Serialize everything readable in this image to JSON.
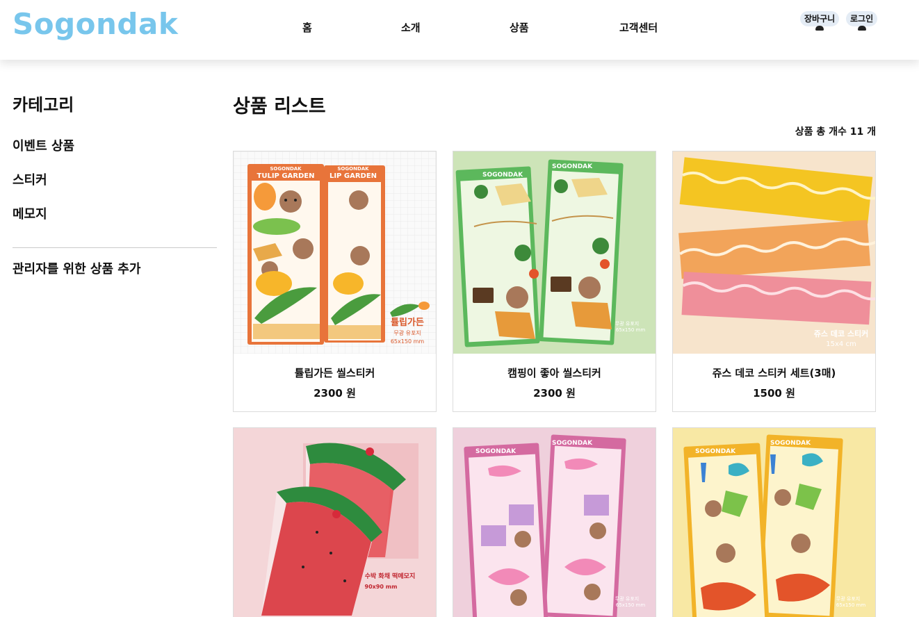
{
  "header": {
    "logo": "Sogondak",
    "nav": [
      "홈",
      "소개",
      "상품",
      "고객센터"
    ],
    "cart": "장바구니",
    "login": "로그인"
  },
  "sidebar": {
    "title": "카테고리",
    "items": [
      "이벤트 상품",
      "스티커",
      "메모지"
    ],
    "admin": "관리자를 위한 상품 추가"
  },
  "main": {
    "title": "상품 리스트",
    "count": "상품 총 개수 11 개"
  },
  "products": [
    {
      "name": "튤립가든 씰스티커",
      "price": "2300 원",
      "img": {
        "brand": "SOGONDAK",
        "title": "TULIP GARDEN",
        "caption1": "튤립가든",
        "caption2": "무광 유포지",
        "caption3": "65x150 mm"
      }
    },
    {
      "name": "캠핑이 좋아 씰스티커",
      "price": "2300 원",
      "img": {
        "brand": "SOGONDAK",
        "caption1": "무광 유포지",
        "caption2": "65x150 mm"
      }
    },
    {
      "name": "쥬스 데코 스티커 세트(3매)",
      "price": "1500 원",
      "img": {
        "caption1": "쥬스 데코 스티커",
        "caption2": "15x4 cm"
      }
    },
    {
      "name": "",
      "price": "",
      "img": {
        "caption1": "수박 화채 떡메모지",
        "caption2": "90x90 mm"
      }
    },
    {
      "name": "",
      "price": "",
      "img": {
        "brand": "SOGONDAK",
        "caption1": "무광 유포지",
        "caption2": "65x150 mm"
      }
    },
    {
      "name": "",
      "price": "",
      "img": {
        "brand": "SOGONDAK",
        "caption1": "무광 유포지",
        "caption2": "65x150 mm"
      }
    }
  ],
  "colors": {
    "logo": "#78c6ec",
    "tag_bg": "#e4ecf5"
  }
}
